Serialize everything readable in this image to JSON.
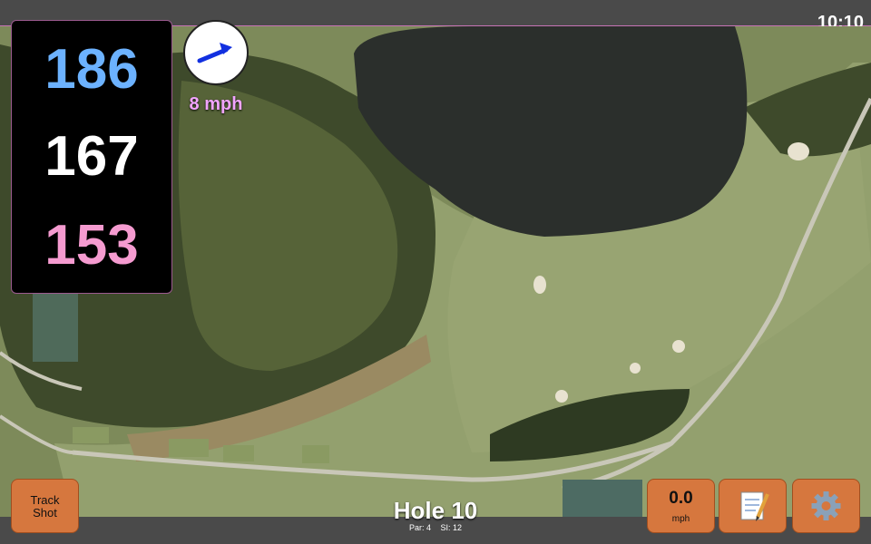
{
  "status_bar": {
    "time": "10:10"
  },
  "distances": {
    "back": "186",
    "middle": "167",
    "front": "153"
  },
  "wind": {
    "speed_text": "8 mph",
    "icon": "arrow-icon"
  },
  "buttons": {
    "track_shot": {
      "line1": "Track",
      "line2": "Shot"
    },
    "speed": {
      "value": "0.0",
      "unit": "mph"
    },
    "notes_icon": "notepad-icon",
    "settings_icon": "gear-icon"
  },
  "hole": {
    "title": "Hole 10",
    "par": "Par: 4",
    "si": "SI: 12"
  },
  "colors": {
    "back": "#6cb2ff",
    "middle": "#ffffff",
    "front": "#f59bd0",
    "button": "#d6773e",
    "wind_text": "#f2a4ff"
  }
}
